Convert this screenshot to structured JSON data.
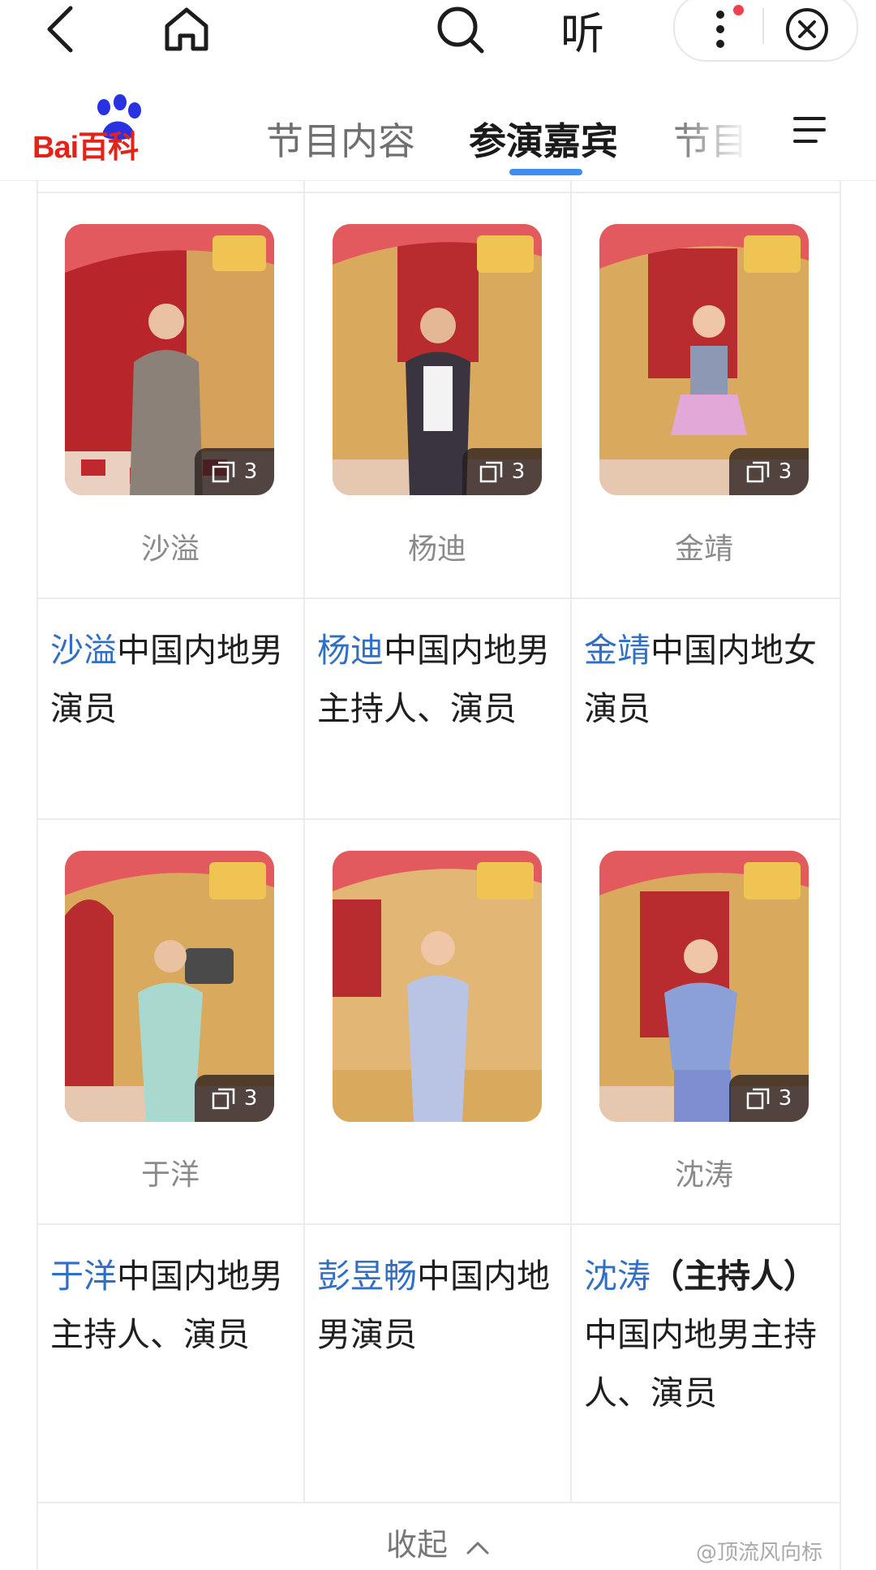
{
  "browser": {
    "listen_label": "听"
  },
  "header": {
    "logo_text": "Bai百科",
    "tabs": [
      {
        "label": "节目内容"
      },
      {
        "label": "参演嘉宾"
      },
      {
        "label": "节目"
      }
    ]
  },
  "cast": [
    {
      "name_label": "沙溢",
      "link": "沙溢",
      "pre_bold": "",
      "desc": "中国内地男演员",
      "photo_count": "3"
    },
    {
      "name_label": "杨迪",
      "link": "杨迪",
      "pre_bold": "",
      "desc": "中国内地男主持人、演员",
      "photo_count": "3"
    },
    {
      "name_label": "金靖",
      "link": "金靖",
      "pre_bold": "",
      "desc": "中国内地女演员",
      "photo_count": "3"
    },
    {
      "name_label": "于洋",
      "link": "于洋",
      "pre_bold": "",
      "desc": "中国内地男主持人、演员",
      "photo_count": "3"
    },
    {
      "name_label": "",
      "link": "彭昱畅",
      "pre_bold": "",
      "desc": "中国内地男演员",
      "photo_count": ""
    },
    {
      "name_label": "沈涛",
      "link": "沈涛",
      "pre_bold": "（主持人）",
      "desc": "中国内地男主持人、演员",
      "photo_count": "3"
    }
  ],
  "footer": {
    "collapse_label": "收起",
    "watermark": "@顶流风向标"
  },
  "colors": {
    "accent_blue": "#3f8cf3",
    "link_blue": "#2f6fc4",
    "baidu_red": "#e2231a",
    "badge_dot": "#f0404c"
  }
}
